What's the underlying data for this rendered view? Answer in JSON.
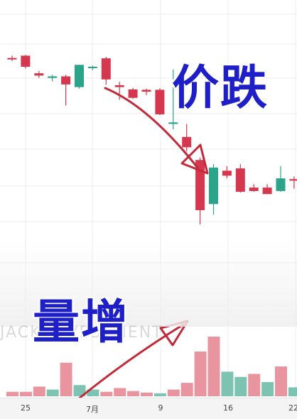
{
  "annotations": {
    "price_label": "价跌",
    "volume_label": "量增",
    "watermark": "JACK  INVESTMENT"
  },
  "colors": {
    "up": "#2ba58a",
    "down": "#d5384e",
    "up_volume": "#7ec3b2",
    "down_volume": "#e8959f",
    "label": "#1f1fc8",
    "arrow": "#c22a3a"
  },
  "chart_data": {
    "type": "candlestick",
    "x_ticks": [
      "25",
      "7月",
      "9",
      "16",
      "22"
    ],
    "candles": [
      {
        "o": 96.0,
        "h": 96.6,
        "l": 95.2,
        "c": 95.6
      },
      {
        "o": 96.6,
        "h": 96.8,
        "l": 93.2,
        "c": 93.7
      },
      {
        "o": 92.0,
        "h": 92.6,
        "l": 90.8,
        "c": 91.4
      },
      {
        "o": 90.8,
        "h": 91.6,
        "l": 89.9,
        "c": 91.2
      },
      {
        "o": 91.2,
        "h": 91.6,
        "l": 83.6,
        "c": 89.1
      },
      {
        "o": 88.4,
        "h": 94.2,
        "l": 88.0,
        "c": 94.2
      },
      {
        "o": 93.4,
        "h": 94.0,
        "l": 92.8,
        "c": 93.7
      },
      {
        "o": 95.9,
        "h": 96.3,
        "l": 89.0,
        "c": 90.4
      },
      {
        "o": 88.9,
        "h": 89.8,
        "l": 85.1,
        "c": 88.4
      },
      {
        "o": 87.8,
        "h": 88.2,
        "l": 85.3,
        "c": 85.6
      },
      {
        "o": 87.7,
        "h": 88.0,
        "l": 86.3,
        "c": 87.2
      },
      {
        "o": 87.7,
        "h": 88.1,
        "l": 81.1,
        "c": 81.3
      },
      {
        "o": 78.8,
        "h": 93.0,
        "l": 77.4,
        "c": 79.2
      },
      {
        "o": 75.4,
        "h": 78.8,
        "l": 71.6,
        "c": 72.7
      },
      {
        "o": 69.4,
        "h": 70.0,
        "l": 52.6,
        "c": 56.3
      },
      {
        "o": 57.9,
        "h": 68.3,
        "l": 55.1,
        "c": 67.4
      },
      {
        "o": 66.6,
        "h": 67.8,
        "l": 64.6,
        "c": 65.3
      },
      {
        "o": 67.2,
        "h": 68.3,
        "l": 60.9,
        "c": 61.1
      },
      {
        "o": 62.2,
        "h": 63.1,
        "l": 61.1,
        "c": 61.3
      },
      {
        "o": 62.2,
        "h": 63.1,
        "l": 60.9,
        "c": 60.5
      },
      {
        "o": 61.3,
        "h": 67.8,
        "l": 61.1,
        "c": 64.6
      },
      {
        "o": 64.4,
        "h": 65.1,
        "l": 61.9,
        "c": 64.0
      },
      {
        "o": 62.2,
        "h": 63.1,
        "l": 60.9,
        "c": 61.7
      }
    ],
    "volumes": [
      {
        "v": 6,
        "dir": "down"
      },
      {
        "v": 6,
        "dir": "down"
      },
      {
        "v": 13,
        "dir": "down"
      },
      {
        "v": 9,
        "dir": "up"
      },
      {
        "v": 45,
        "dir": "down"
      },
      {
        "v": 15,
        "dir": "up"
      },
      {
        "v": 9,
        "dir": "up"
      },
      {
        "v": 6,
        "dir": "down"
      },
      {
        "v": 11,
        "dir": "down"
      },
      {
        "v": 7,
        "dir": "down"
      },
      {
        "v": 5,
        "dir": "down"
      },
      {
        "v": 4,
        "dir": "up"
      },
      {
        "v": 9,
        "dir": "down"
      },
      {
        "v": 18,
        "dir": "down"
      },
      {
        "v": 60,
        "dir": "down"
      },
      {
        "v": 80,
        "dir": "down"
      },
      {
        "v": 33,
        "dir": "up"
      },
      {
        "v": 26,
        "dir": "up"
      },
      {
        "v": 30,
        "dir": "down"
      },
      {
        "v": 19,
        "dir": "up"
      },
      {
        "v": 40,
        "dir": "down"
      },
      {
        "v": 12,
        "dir": "up"
      },
      {
        "v": 7,
        "dir": "up"
      },
      {
        "v": 14,
        "dir": "down"
      }
    ]
  }
}
